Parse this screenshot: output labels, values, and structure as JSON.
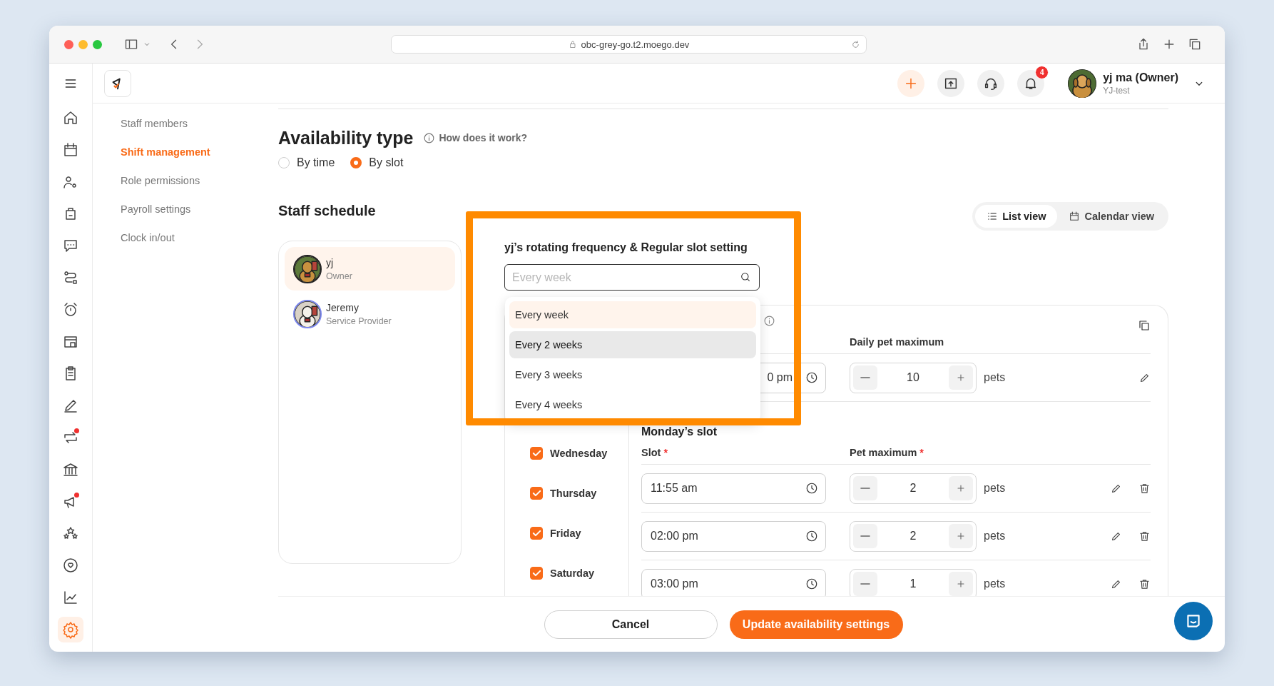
{
  "browser": {
    "url": "obc-grey-go.t2.moego.dev"
  },
  "header": {
    "notification_count": "4",
    "user": {
      "name": "yj ma (Owner)",
      "business": "YJ-test"
    }
  },
  "rail": [
    {
      "kind": "home",
      "selected": false,
      "has_dot": false
    },
    {
      "kind": "calendar",
      "selected": false,
      "has_dot": false
    },
    {
      "kind": "client",
      "selected": false,
      "has_dot": false
    },
    {
      "kind": "bag",
      "selected": false,
      "has_dot": false
    },
    {
      "kind": "chat",
      "selected": false,
      "has_dot": false
    },
    {
      "kind": "route",
      "selected": false,
      "has_dot": false
    },
    {
      "kind": "alarm",
      "selected": false,
      "has_dot": false
    },
    {
      "kind": "store",
      "selected": false,
      "has_dot": false
    },
    {
      "kind": "clipboard",
      "selected": false,
      "has_dot": false
    },
    {
      "kind": "pen",
      "selected": false,
      "has_dot": false
    },
    {
      "kind": "swap",
      "selected": false,
      "has_dot": true
    },
    {
      "kind": "bank",
      "selected": false,
      "has_dot": false
    },
    {
      "kind": "megaphone",
      "selected": false,
      "has_dot": true
    },
    {
      "kind": "stars",
      "selected": false,
      "has_dot": false
    },
    {
      "kind": "heart",
      "selected": false,
      "has_dot": false
    },
    {
      "kind": "chart",
      "selected": false,
      "has_dot": false
    },
    {
      "kind": "settings",
      "selected": true,
      "has_dot": false
    }
  ],
  "settings_nav": [
    {
      "label": "Staff members",
      "selected": false
    },
    {
      "label": "Shift management",
      "selected": true
    },
    {
      "label": "Role permissions",
      "selected": false
    },
    {
      "label": "Payroll settings",
      "selected": false
    },
    {
      "label": "Clock in/out",
      "selected": false
    }
  ],
  "availability": {
    "title": "Availability type",
    "help": "How does it work?",
    "options": [
      {
        "label": "By time",
        "selected": false
      },
      {
        "label": "By slot",
        "selected": true
      }
    ]
  },
  "schedule": {
    "title": "Staff schedule",
    "views": [
      {
        "label": "List view",
        "kind": "list",
        "selected": true
      },
      {
        "label": "Calendar view",
        "kind": "calendar",
        "selected": false
      }
    ],
    "staff": [
      {
        "name": "yj",
        "role": "Owner",
        "selected": true
      },
      {
        "name": "Jeremy",
        "role": "Service Provider",
        "selected": false
      }
    ],
    "rotation": {
      "title": "yj’s rotating frequency & Regular slot setting",
      "placeholder": "Every week",
      "options": [
        {
          "label": "Every week",
          "selected": true,
          "highlighted": false
        },
        {
          "label": "Every 2 weeks",
          "selected": false,
          "highlighted": true
        },
        {
          "label": "Every 3 weeks",
          "selected": false,
          "highlighted": false
        },
        {
          "label": "Every 4 weeks",
          "selected": false,
          "highlighted": false
        }
      ]
    },
    "daily": {
      "column": "Daily pet maximum",
      "time": "0 pm",
      "value": "10",
      "unit": "pets"
    },
    "days": [
      {
        "label": "Wednesday",
        "checked": true
      },
      {
        "label": "Thursday",
        "checked": true
      },
      {
        "label": "Friday",
        "checked": true
      },
      {
        "label": "Saturday",
        "checked": true
      }
    ],
    "slots": {
      "title": "Monday’s slot",
      "columns": [
        {
          "label": "Slot",
          "required_mark": "*"
        },
        {
          "label": "Pet maximum",
          "required_mark": "*"
        }
      ],
      "rows": [
        {
          "time": "11:55 am",
          "value": "2",
          "unit": "pets"
        },
        {
          "time": "02:00 pm",
          "value": "2",
          "unit": "pets"
        },
        {
          "time": "03:00 pm",
          "value": "1",
          "unit": "pets"
        }
      ]
    }
  },
  "footer": {
    "cancel": "Cancel",
    "submit": "Update availability settings"
  }
}
